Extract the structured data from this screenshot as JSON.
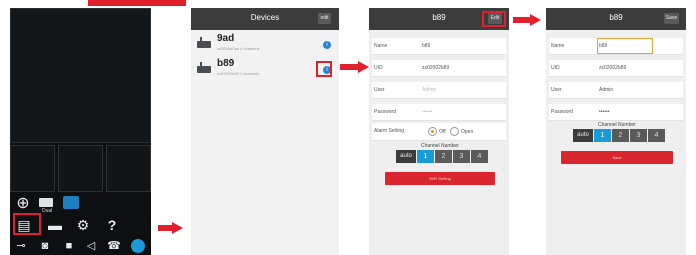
{
  "panel_devices": {
    "title": "Devices",
    "top_button": "edit",
    "devices": [
      {
        "name": "9ad",
        "subtitle": "ca3006d0ad 4 channels"
      },
      {
        "name": "b89",
        "subtitle": "zz02002b89 1 channels"
      }
    ]
  },
  "panel_edit": {
    "title": "b89",
    "top_button": "Edit",
    "fields": [
      {
        "label": "Name",
        "value": "b89",
        "placeholder": false
      },
      {
        "label": "UID",
        "value": "zz02002b89",
        "placeholder": false
      },
      {
        "label": "User",
        "value": "Admin",
        "placeholder": true
      },
      {
        "label": "Password",
        "value": "••••••",
        "placeholder": true
      }
    ],
    "alarm_label": "Alarm Setting",
    "alarm_off": "Off",
    "alarm_open": "Open",
    "channel_caption": "Channel Number",
    "channels": [
      "auto",
      "1",
      "2",
      "3",
      "4"
    ],
    "selected_channel": "1",
    "bottom_button": "WiFi Setting"
  },
  "panel_save": {
    "title": "b89",
    "top_button": "Save",
    "fields": [
      {
        "label": "Name",
        "value": "b89"
      },
      {
        "label": "UID",
        "value": "zz02002b89"
      },
      {
        "label": "User",
        "value": "Admin"
      },
      {
        "label": "Password",
        "value": "••••••"
      }
    ],
    "channel_caption": "Channel Number",
    "channels": [
      "auto",
      "1",
      "2",
      "3",
      "4"
    ],
    "selected_channel": "1",
    "bottom_button": "Save"
  },
  "live_view": {
    "toolbar_rows": [
      [
        "plus-circle-icon",
        "hdd-icon",
        "camera-tile-icon"
      ],
      [
        "list-icon",
        "folder-icon",
        "gear-icon",
        "help-icon"
      ],
      [
        "key-icon",
        "snapshot-icon",
        "record-icon",
        "speaker-icon",
        "call-icon",
        "ptz-icon"
      ]
    ],
    "hdd_label": "Dual",
    "help_glyph": "?"
  },
  "colors": {
    "accent_red": "#e0202a",
    "accent_blue": "#1b9ad8",
    "topbar": "#3c3c3c"
  }
}
